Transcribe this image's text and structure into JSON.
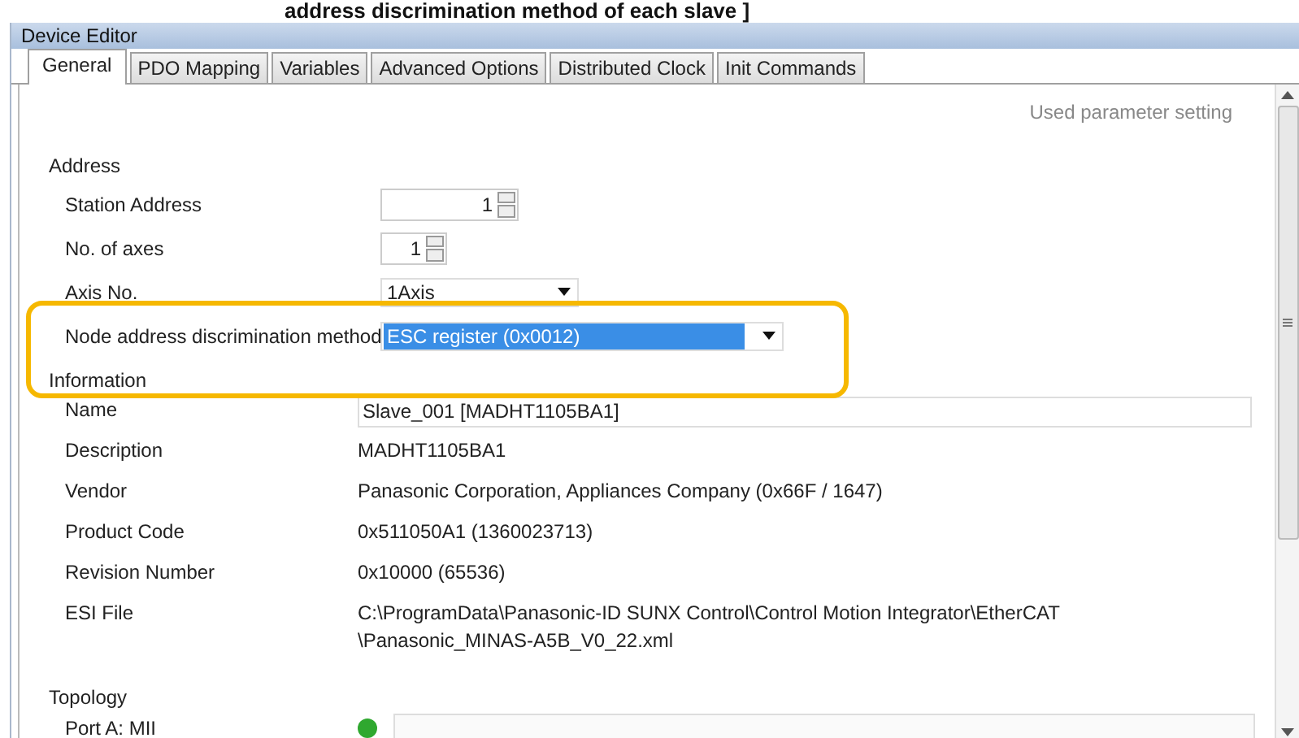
{
  "caption": "address discrimination method of each slave ]",
  "window": {
    "title": "Device Editor"
  },
  "tabs": [
    {
      "label": "General",
      "selected": true
    },
    {
      "label": "PDO Mapping",
      "selected": false
    },
    {
      "label": "Variables",
      "selected": false
    },
    {
      "label": "Advanced Options",
      "selected": false
    },
    {
      "label": "Distributed Clock",
      "selected": false
    },
    {
      "label": "Init Commands",
      "selected": false
    }
  ],
  "used_parameter_setting": "Used parameter setting",
  "address": {
    "heading": "Address",
    "fields": [
      {
        "label": "Station Address",
        "kind": "spin",
        "value": "1",
        "wide": true
      },
      {
        "label": "No. of axes",
        "kind": "spin",
        "value": "1",
        "wide": false
      },
      {
        "label": "Axis No.",
        "kind": "dropdown",
        "value": "1Axis",
        "highlighted": false
      },
      {
        "label": "Node address discrimination method",
        "kind": "dropdown",
        "value": "ESC register (0x0012)",
        "highlighted": true,
        "annotated": true
      }
    ]
  },
  "information": {
    "heading": "Information",
    "rows": [
      {
        "label": "Name",
        "kind": "field",
        "lines": [
          "Slave_001 [MADHT1105BA1]"
        ]
      },
      {
        "label": "Description",
        "kind": "text",
        "lines": [
          "MADHT1105BA1"
        ]
      },
      {
        "label": "Vendor",
        "kind": "text",
        "lines": [
          "Panasonic Corporation, Appliances Company (0x66F / 1647)"
        ]
      },
      {
        "label": "Product Code",
        "kind": "text",
        "lines": [
          "0x511050A1 (1360023713)"
        ]
      },
      {
        "label": "Revision Number",
        "kind": "text",
        "lines": [
          "0x10000 (65536)"
        ]
      },
      {
        "label": "ESI File",
        "kind": "text",
        "lines": [
          "C:\\ProgramData\\Panasonic-ID SUNX Control\\Control Motion Integrator\\EtherCAT",
          "\\Panasonic_MINAS-A5B_V0_22.xml"
        ]
      }
    ]
  },
  "topology": {
    "heading": "Topology",
    "ports": [
      {
        "label": "Port A: MII",
        "color": "#2fa82f"
      }
    ]
  }
}
